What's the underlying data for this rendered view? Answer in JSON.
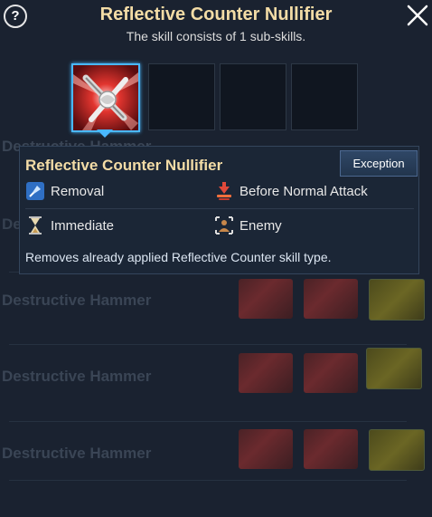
{
  "header": {
    "help_label": "?",
    "title": "Reflective Counter Nullifier",
    "subtitle": "The skill consists of 1 sub-skills."
  },
  "slots": [
    {
      "state": "selected",
      "icon": "crossed-blades-icon"
    },
    {
      "state": "empty"
    },
    {
      "state": "empty"
    },
    {
      "state": "empty"
    }
  ],
  "detail": {
    "name": "Reflective Counter Nullifier",
    "exception_label": "Exception",
    "attributes": [
      {
        "icon": "removal-icon",
        "label": "Removal"
      },
      {
        "icon": "before-attack-icon",
        "label": "Before Normal Attack"
      },
      {
        "icon": "hourglass-icon",
        "label": "Immediate"
      },
      {
        "icon": "enemy-target-icon",
        "label": "Enemy"
      }
    ],
    "description": "Removes already applied Reflective Counter skill type."
  },
  "background": {
    "row_label": "Destructive Hammer"
  },
  "colors": {
    "title": "#f3dca6",
    "selected_border": "#49b8ff",
    "panel_bg": "#1b2636"
  }
}
